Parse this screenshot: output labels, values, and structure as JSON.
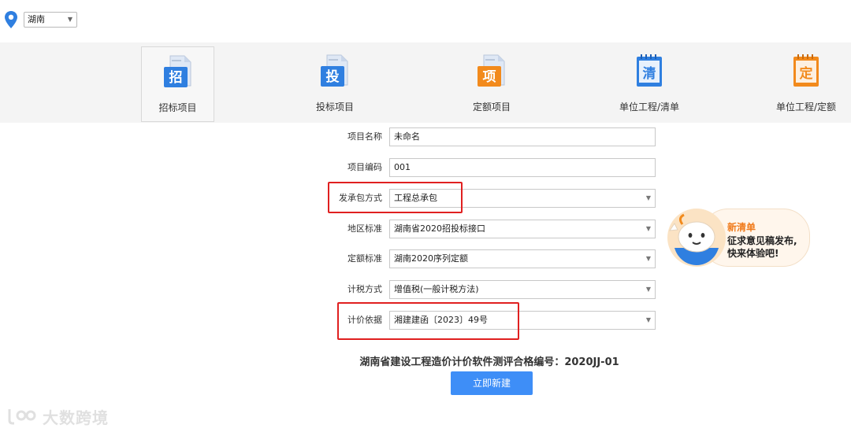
{
  "region": {
    "value": "湖南"
  },
  "nav": [
    {
      "label": "招标项目",
      "glyph": "招",
      "color": "#2f7fe0",
      "active": true
    },
    {
      "label": "投标项目",
      "glyph": "投",
      "color": "#2f7fe0",
      "active": false
    },
    {
      "label": "定额项目",
      "glyph": "项",
      "color": "#f28a1c",
      "active": false
    },
    {
      "label": "单位工程/清单",
      "glyph": "清",
      "color": "#2f7fe0",
      "active": false
    },
    {
      "label": "单位工程/定额",
      "glyph": "定",
      "color": "#f28a1c",
      "active": false
    }
  ],
  "form": {
    "project_name": {
      "label": "项目名称",
      "value": "未命名"
    },
    "project_code": {
      "label": "项目编码",
      "value": "001"
    },
    "contract_mode": {
      "label": "发承包方式",
      "value": "工程总承包"
    },
    "region_standard": {
      "label": "地区标准",
      "value": "湖南省2020招投标接口"
    },
    "quota_standard": {
      "label": "定额标准",
      "value": "湖南2020序列定额"
    },
    "tax_method": {
      "label": "计税方式",
      "value": "增值税(一般计税方法)"
    },
    "pricing_basis": {
      "label": "计价依据",
      "value": "湘建建函〔2023〕49号"
    }
  },
  "certificate": "湖南省建设工程造价计价软件测评合格编号：2020JJ-01",
  "create_button": "立即新建",
  "promo": {
    "title": "新清单",
    "line1": "征求意见稿发布,",
    "line2": "快来体验吧!"
  },
  "watermark": "大数跨境",
  "colors": {
    "accent": "#3e8ef7",
    "highlight": "#e02020",
    "orange": "#f07a1a"
  }
}
